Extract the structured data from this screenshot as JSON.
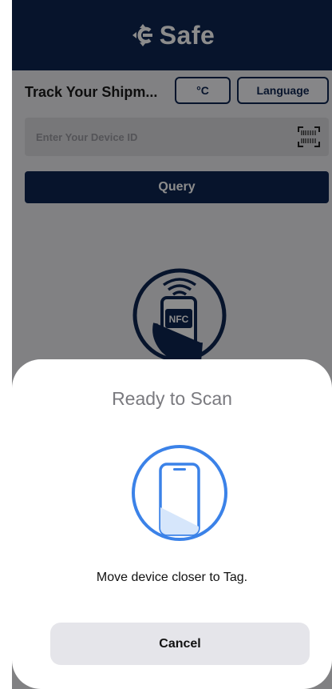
{
  "header": {
    "brand": "Safe"
  },
  "track": {
    "title": "Track Your Shipm...",
    "unit_label": "°C",
    "language_label": "Language"
  },
  "search": {
    "placeholder": "Enter Your Device ID",
    "value": ""
  },
  "query": {
    "label": "Query"
  },
  "nfc": {
    "label": "NFC"
  },
  "sheet": {
    "title": "Ready to Scan",
    "message": "Move device closer to Tag.",
    "cancel_label": "Cancel"
  },
  "colors": {
    "brand": "#0e2550",
    "scan_accent": "#3b82e8"
  }
}
